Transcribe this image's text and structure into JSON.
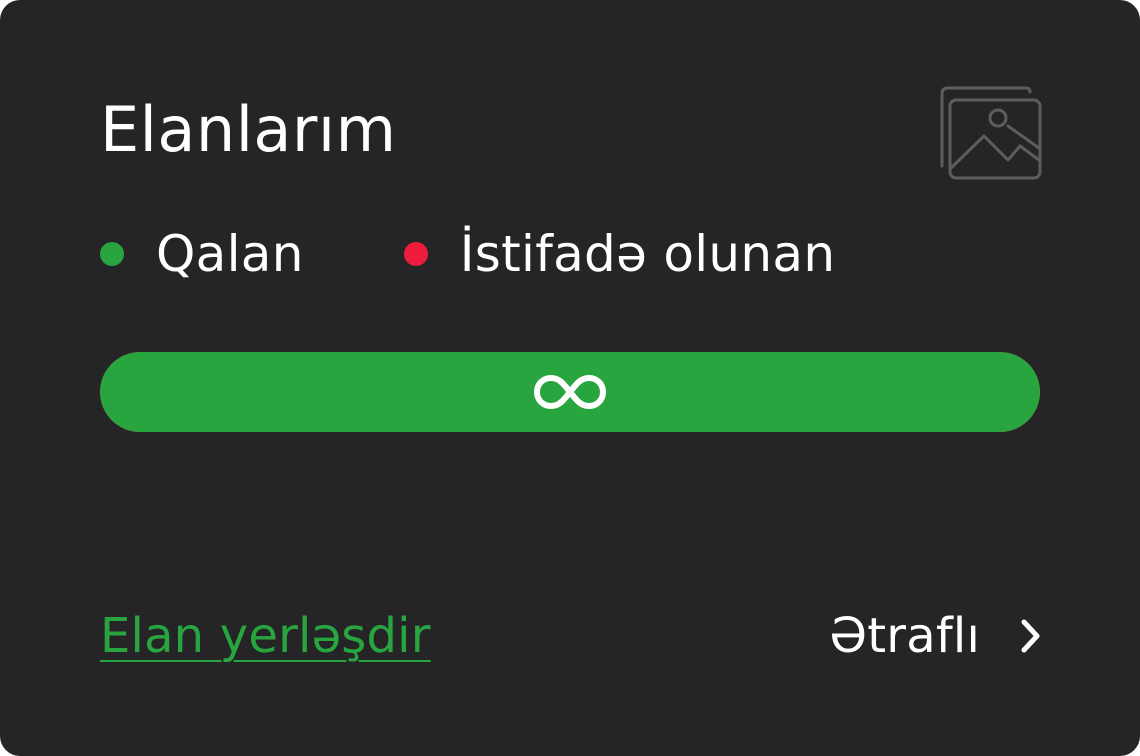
{
  "card": {
    "title": "Elanlarım",
    "image_icon": "image-gallery-icon"
  },
  "legend": {
    "remaining": {
      "label": "Qalan",
      "color": "#29a53f"
    },
    "used": {
      "label": "İstifadə olunan",
      "color": "#ee1c3c"
    }
  },
  "usage_bar": {
    "remaining_fraction": 1.0,
    "remaining_color": "#29a53f",
    "used_color": "#ee1c3c",
    "value_icon": "infinity-icon"
  },
  "footer": {
    "post_ad_label": "Elan yerləşdir",
    "details_label": "Ətraflı",
    "details_icon": "chevron-right-icon"
  }
}
